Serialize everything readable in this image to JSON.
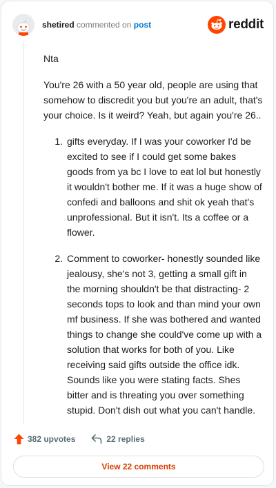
{
  "header": {
    "username": "shetired",
    "action_text": "commented on",
    "post_link": "post",
    "brand_word": "reddit"
  },
  "comment": {
    "paragraphs": [
      "Nta",
      "You're 26 with a 50 year old, people are using that somehow to discredit you but you're an adult, that's your choice. Is it weird? Yeah, but again you're 26.."
    ],
    "list_items": [
      "gifts everyday. If I was your coworker I'd be excited to see if I could get some bakes goods from ya bc I love to eat lol but honestly it wouldn't bother me. If it was a huge show of confedi and balloons and shit ok yeah that's unprofessional. But it isn't. Its a coffee or a flower.",
      "Comment to coworker- honestly sounded like jealousy, she's not 3, getting a small gift in the morning shouldn't be that distracting- 2 seconds tops to look and than mind your own mf business. If she was bothered and wanted things to change she could've come up with a solution that works for both of you. Like receiving said gifts outside the office idk. Sounds like you were stating facts. Shes bitter and is threating you over something stupid. Don't dish out what you can't handle."
    ]
  },
  "footer": {
    "upvotes": "382 upvotes",
    "replies": "22 replies",
    "view_button": "View 22 comments"
  },
  "colors": {
    "brand": "#ff4500",
    "link": "#0079d3",
    "view_button_text": "#d93a00",
    "muted": "#576f76"
  },
  "icons": [
    "avatar-icon",
    "reddit-logo-icon",
    "upvote-arrow-icon",
    "reply-arrow-icon"
  ]
}
